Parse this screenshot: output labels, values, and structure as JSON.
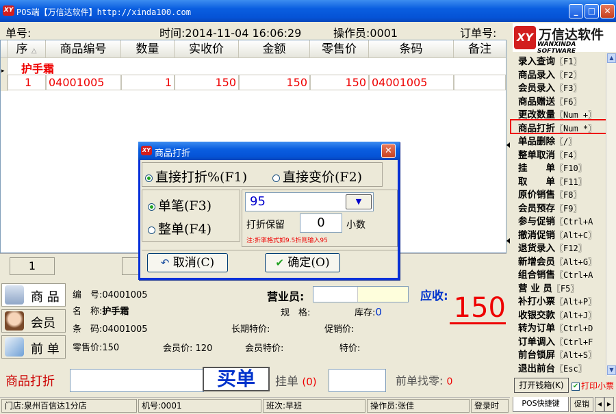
{
  "window": {
    "title": "POS端【万信达软件】http://xinda100.com",
    "minimize": "_",
    "maximize": "□",
    "close": "✕",
    "logo_text": "XY"
  },
  "info": {
    "order_no_label": "单号:",
    "time_label": "时间:2014-11-04 16:06:29",
    "operator_label": "操作员:0001",
    "ticket_label": "订单号:"
  },
  "grid": {
    "columns": [
      "序",
      "商品编号",
      "数量",
      "实收价",
      "金额",
      "零售价",
      "条码",
      "备注"
    ],
    "sort_indicator": "△",
    "row_marker": "▸",
    "group_label": "护手霜",
    "rows": [
      {
        "seq": "1",
        "code": "04001005",
        "qty": "1",
        "actual_price": "150",
        "amount": "150",
        "retail_price": "150",
        "barcode": "04001005",
        "remark": ""
      }
    ],
    "footer_count": "1"
  },
  "brand": {
    "logo_text": "XY",
    "name": "万信达软件",
    "slogan": "WANXINDA SOFTWARE"
  },
  "shortcuts": [
    {
      "label": "录入查询",
      "key": "〖F1〗"
    },
    {
      "label": "商品录入",
      "key": "〖F2〗"
    },
    {
      "label": "会员录入",
      "key": "〖F3〗"
    },
    {
      "label": "商品赠送",
      "key": "〖F6〗"
    },
    {
      "label": "更改数量",
      "key": "〖Num +〗"
    },
    {
      "label": "商品打折",
      "key": "〖Num *〗"
    },
    {
      "label": "单品删除",
      "key": "〖/〗"
    },
    {
      "label": "整单取消",
      "key": "〖F4〗"
    },
    {
      "label": "挂　　单",
      "key": "〖F10〗"
    },
    {
      "label": "取　　单",
      "key": "〖F11〗"
    },
    {
      "label": "原价销售",
      "key": "〖F8〗"
    },
    {
      "label": "会员预存",
      "key": "〖F9〗"
    },
    {
      "label": "参与促销",
      "key": "〖Ctrl+A"
    },
    {
      "label": "撤消促销",
      "key": "〖Alt+C〗"
    },
    {
      "label": "退货录入",
      "key": "〖F12〗"
    },
    {
      "label": "新增会员",
      "key": "〖Alt+G〗"
    },
    {
      "label": "组合销售",
      "key": "〖Ctrl+A"
    },
    {
      "label": "营 业 员",
      "key": "〖F5〗"
    },
    {
      "label": "补打小票",
      "key": "〖Alt+P〗"
    },
    {
      "label": "收银交款",
      "key": "〖Alt+J〗"
    },
    {
      "label": "转为订单",
      "key": "〖Ctrl+D"
    },
    {
      "label": "订单调入",
      "key": "〖Ctrl+F"
    },
    {
      "label": "前台锁屏",
      "key": "〖Alt+S〗"
    },
    {
      "label": "退出前台",
      "key": "〖Esc〗"
    }
  ],
  "right_bottom": {
    "open_drawer": "打开钱箱(K)",
    "print_receipt": "打印小票",
    "tab1": "POS快捷键",
    "tab2": "促销"
  },
  "dialog": {
    "logo_text": "XY",
    "title": "商品打折",
    "close": "✕",
    "opt_direct_discount": "直接打折%(F1)",
    "opt_direct_price": "直接变价(F2)",
    "opt_single": "单笔(F3)",
    "opt_whole": "整单(F4)",
    "discount_value": "95",
    "dropdown_arrow": "▼",
    "keep_label": "打折保留",
    "keep_value": "0",
    "decimal_label": "小数",
    "note": "注:折率格式如9.5折则输入95",
    "cancel_icon": "↶",
    "cancel": "取消(C)",
    "ok_icon": "✔",
    "ok": "确定(O)"
  },
  "product": {
    "side_goods": "商 品",
    "side_member": "会员",
    "side_prev": "前 单",
    "code_label": "编　号:",
    "code_value": "04001005",
    "name_label": "名　称:",
    "name_value": "护手霜",
    "barcode_label": "条　码:",
    "barcode_value": "04001005",
    "retail_label": "零售价:",
    "retail_value": "150",
    "member_price_label": "会员价:",
    "member_price_value": "120",
    "member_special_label": "会员特价:",
    "special_label": "特价:",
    "long_special_label": "长期特价:",
    "promo_price_label": "促销价:",
    "spec_label": "规　格:",
    "stock_label": "库存:",
    "stock_value": "0",
    "sales_person_label": "营业员:",
    "receivable_label": "应收:",
    "receivable_value": "150"
  },
  "action": {
    "mode_label": "商品打折",
    "buy": "买单",
    "hang_label": "挂单",
    "hang_count": "(0)",
    "prev_change_label": "前单找零:",
    "prev_change_value": "0"
  },
  "status": {
    "store": "门店:泉州百信达1分店",
    "machine": "机号:0001",
    "shift": "班次:早班",
    "operator": "操作员:张佳",
    "login_time": "登录时"
  }
}
